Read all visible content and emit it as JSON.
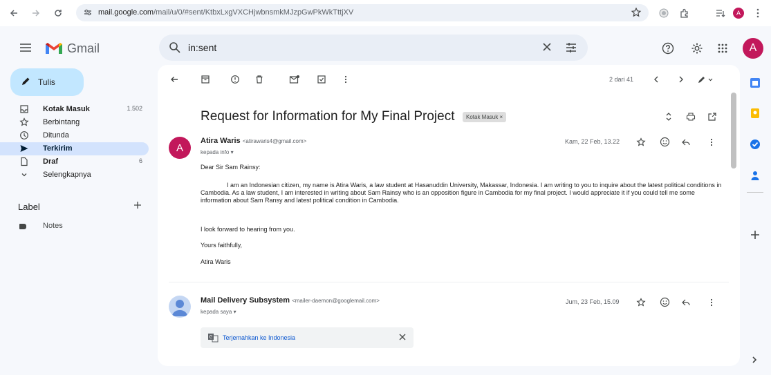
{
  "browser": {
    "url_host": "mail.google.com",
    "url_path": "/mail/u/0/#sent/KtbxLxgVXCHjwbnsmkMJzpGwPkWkTttjXV",
    "profile_initial": "A"
  },
  "header": {
    "app_name": "Gmail",
    "search_value": "in:sent",
    "account_initial": "A"
  },
  "sidebar": {
    "compose_label": "Tulis",
    "items": [
      {
        "label": "Kotak Masuk",
        "count": "1.502"
      },
      {
        "label": "Berbintang",
        "count": ""
      },
      {
        "label": "Ditunda",
        "count": ""
      },
      {
        "label": "Terkirim",
        "count": ""
      },
      {
        "label": "Draf",
        "count": "6"
      },
      {
        "label": "Selengkapnya",
        "count": ""
      }
    ],
    "label_heading": "Label",
    "labels": [
      "Notes"
    ]
  },
  "toolbar": {
    "pager": "2 dari 41"
  },
  "thread": {
    "subject": "Request for Information for My Final Project",
    "inbox_chip": "Kotak Masuk ×",
    "messages": [
      {
        "initial": "A",
        "sender_name": "Atira Waris",
        "sender_email": "<atirawaris4@gmail.com>",
        "to": "kepada info ▾",
        "date": "Kam, 22 Feb, 13.22",
        "greeting": "Dear Sir Sam Rainsy:",
        "paragraph": "I am an Indonesian citizen, my name is Atira Waris, a law student at Hasanuddin University, Makassar, Indonesia. I am writing to you to inquire about the latest political conditions in Cambodia. As a law student, I am interested in writing about Sam Rainsy who is an opposition figure in Cambodia for my final project.  I would appreciate it if you could tell me some information about Sam Ransy and latest political condition in Cambodia.",
        "closing1": "I look forward to hearing from you.",
        "closing2": "Yours faithfully,",
        "signature": "Atira Waris"
      },
      {
        "sender_name": "Mail Delivery Subsystem",
        "sender_email": "<mailer-daemon@googlemail.com>",
        "to": "kepada saya ▾",
        "date": "Jum, 23 Feb, 15.09",
        "translate_label": "Terjemahkan ke Indonesia"
      }
    ]
  },
  "colors": {
    "accent_avatar": "#c2185b",
    "compose_bg": "#c2e7ff",
    "active_nav_bg": "#d3e3fd"
  }
}
